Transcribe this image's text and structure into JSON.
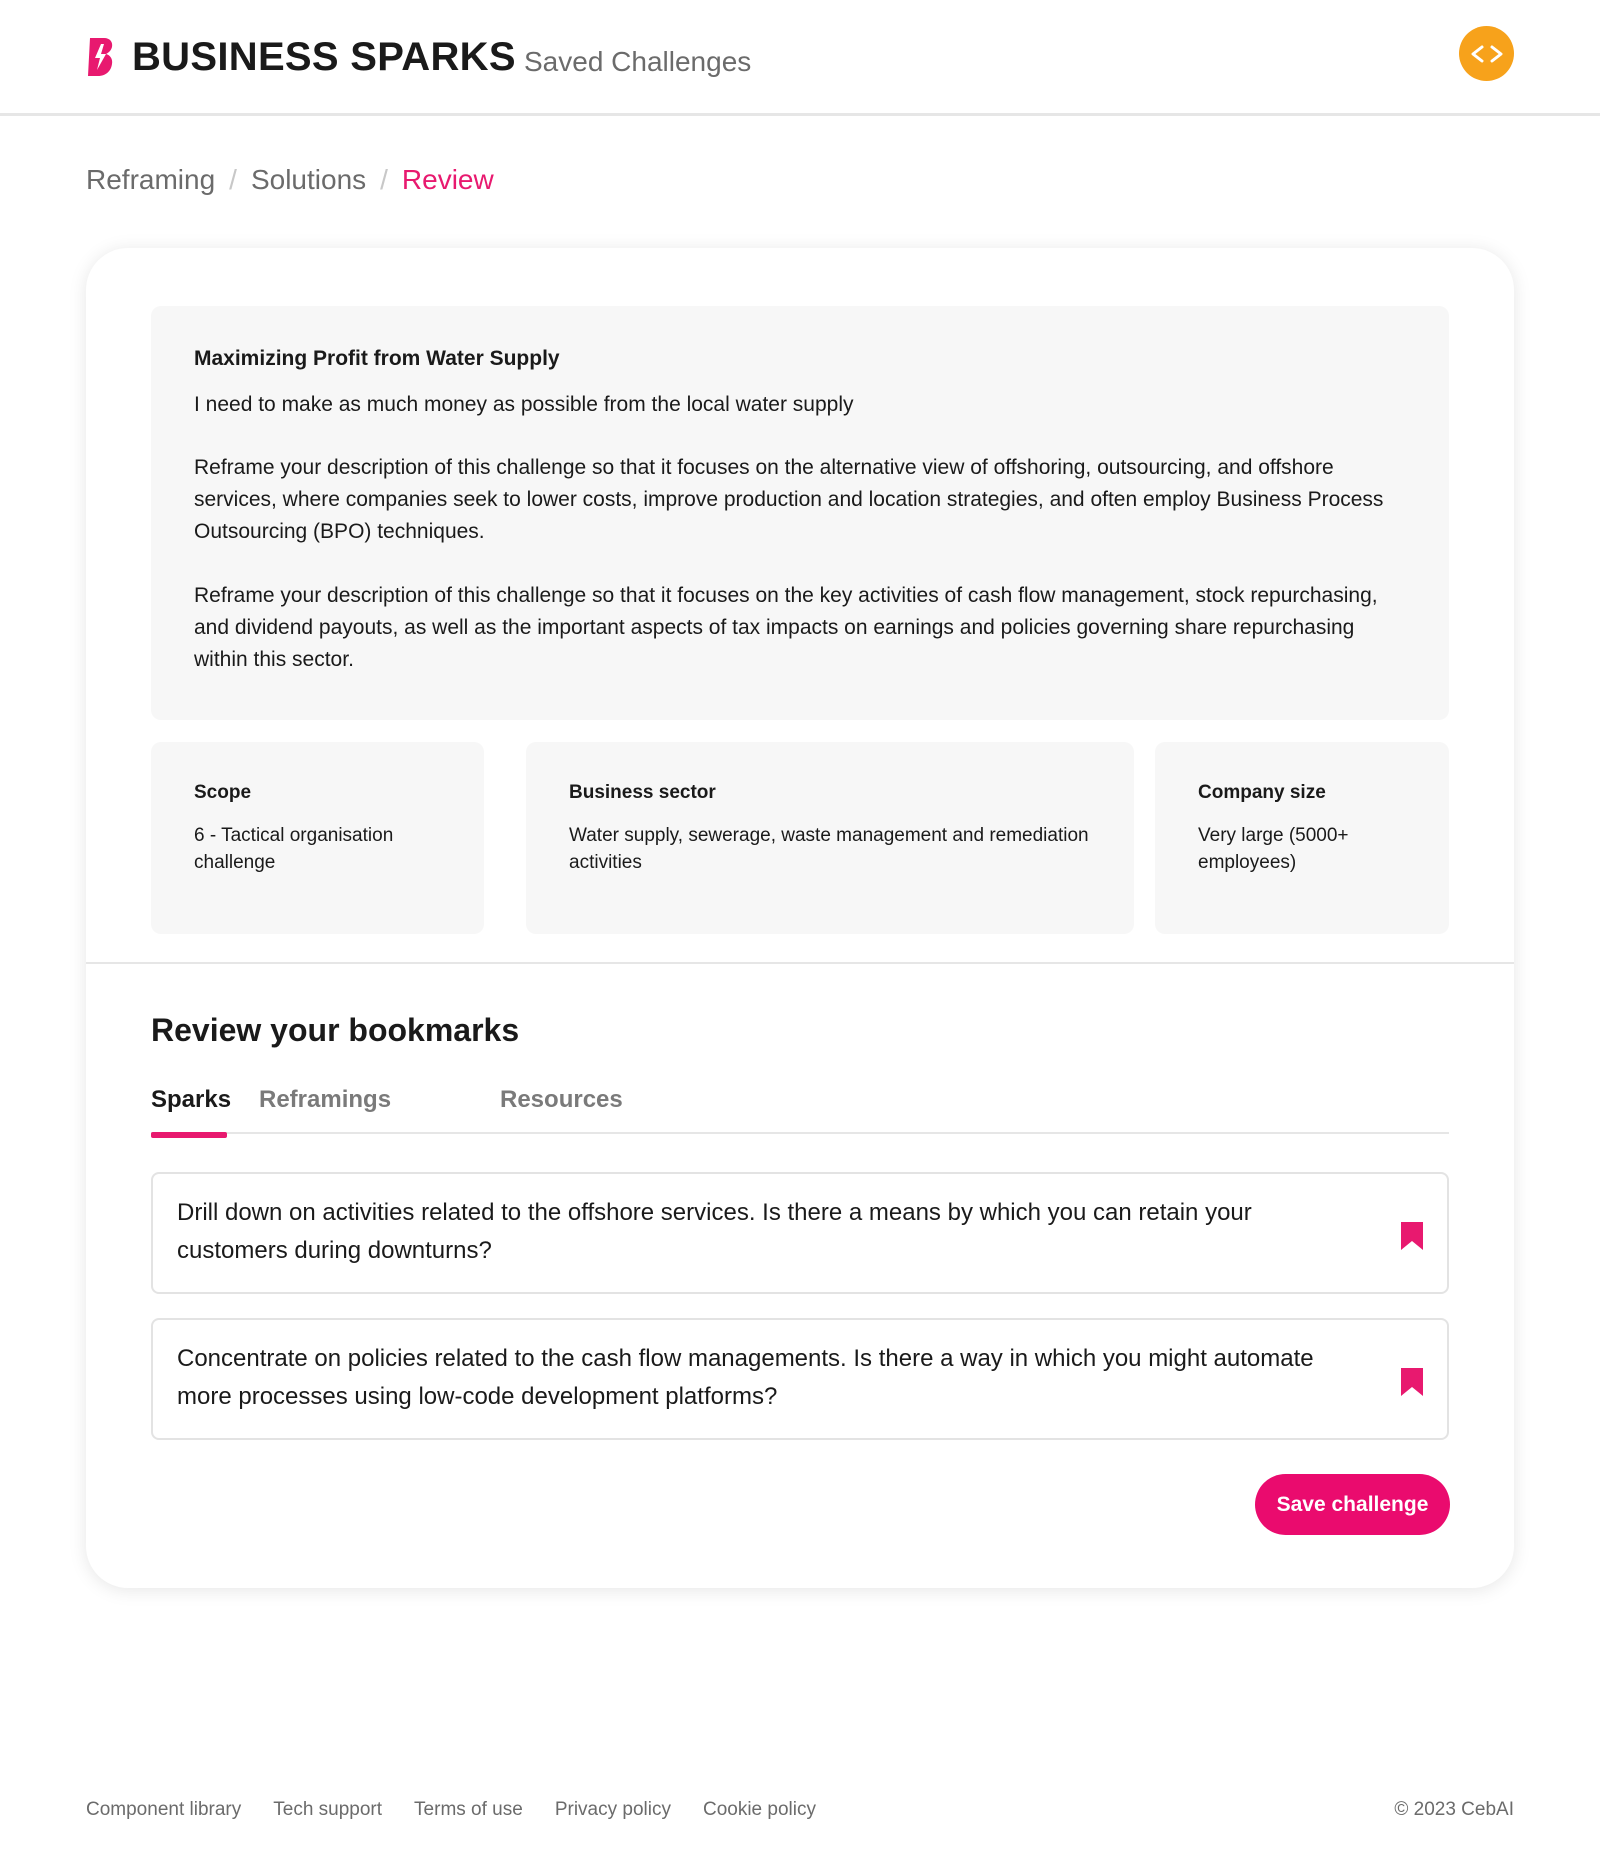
{
  "header": {
    "brand": "BUSINESS SPARKS",
    "saved_link": "Saved Challenges",
    "avatar_icon": "code-brackets-icon",
    "avatar_color": "#f7a21b"
  },
  "breadcrumb": {
    "items": [
      "Reframing",
      "Solutions",
      "Review"
    ],
    "separator": "/"
  },
  "challenge": {
    "title": "Maximizing Profit from Water Supply",
    "statement": "I need to make as much money as possible from the local water supply",
    "reframings": [
      "Reframe your description of this challenge so that it focuses on the alternative view of offshoring, outsourcing, and offshore services, where companies seek to lower costs, improve production and location strategies, and often employ Business Process Outsourcing (BPO) techniques.",
      "Reframe your description of this challenge so that it focuses on the key activities of cash flow management, stock repurchasing, and dividend payouts, as well as the important aspects of tax impacts on earnings and policies governing share repurchasing within this sector."
    ]
  },
  "meta": {
    "scope": {
      "label": "Scope",
      "value": "6 - Tactical organisation challenge"
    },
    "sector": {
      "label": "Business sector",
      "value": "Water supply, sewerage, waste management and remediation activities"
    },
    "size": {
      "label": "Company size",
      "value": "Very large (5000+ employees)"
    }
  },
  "bookmarks": {
    "title": "Review your bookmarks",
    "tabs": [
      "Sparks",
      "Reframings",
      "Resources"
    ],
    "active_tab": "Sparks",
    "sparks": [
      {
        "text": "Drill down on activities related to the offshore services. Is there a means by which you can retain your customers during downturns?",
        "icon": "bookmark-filled-icon"
      },
      {
        "text": "Concentrate on policies related to the cash flow managements. Is there a way in which you might automate more processes using low-code development platforms?",
        "icon": "bookmark-filled-icon"
      }
    ],
    "save_button": "Save challenge"
  },
  "footer": {
    "links": [
      "Component library",
      "Tech support",
      "Terms of use",
      "Privacy policy",
      "Cookie policy"
    ],
    "copyright": "© 2023 CebAI"
  },
  "colors": {
    "accent": "#e8196f",
    "button": "#ea0b6e",
    "panel": "#f7f7f7",
    "muted_text": "#6b6b6b"
  }
}
